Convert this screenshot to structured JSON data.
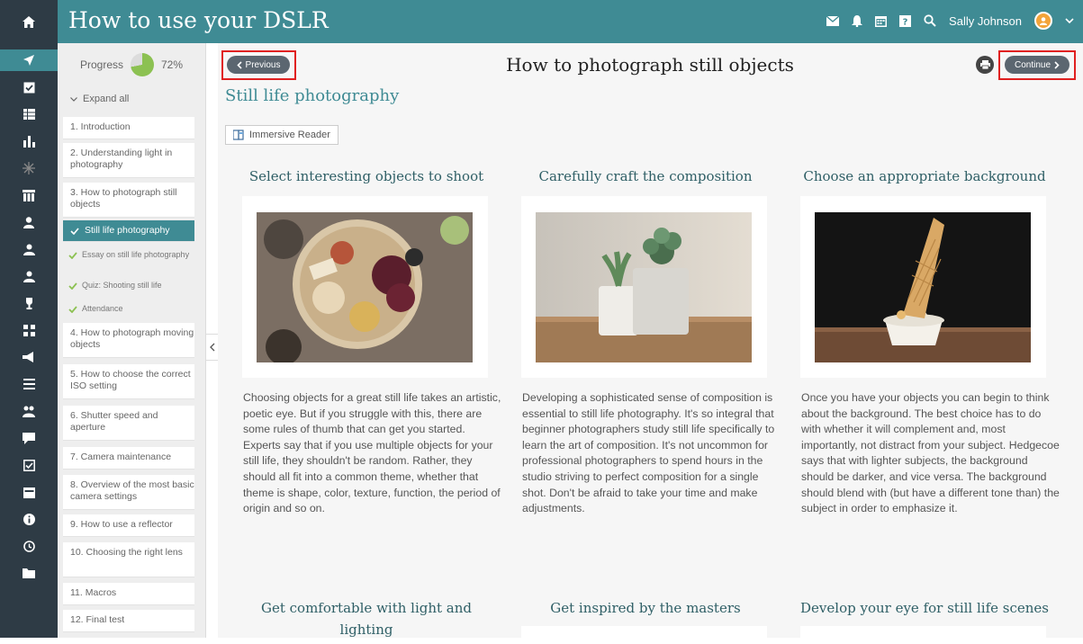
{
  "app": {
    "title": "How to use your DSLR"
  },
  "header": {
    "user_name": "Sally Johnson"
  },
  "toc": {
    "progress_label": "Progress",
    "progress_value": "72%",
    "expand_all": "Expand all",
    "items": [
      "1. Introduction",
      "2. Understanding light in photography",
      "3. How to photograph still objects",
      "Still life photography",
      "Essay on still life photography",
      "Quiz: Shooting still life",
      "Attendance",
      "4. How to photograph moving objects",
      "5. How to choose the correct ISO setting",
      "6. Shutter speed and aperture",
      "7. Camera maintenance",
      "8. Overview of the most basic camera settings",
      "9. How to use a reflector",
      "10. Choosing the right lens",
      "11. Macros",
      "12. Final test"
    ]
  },
  "lesson": {
    "title": "How to photograph still objects",
    "previous_label": "Previous",
    "continue_label": "Continue",
    "section_heading": "Still life photography",
    "reader_label": "Immersive Reader"
  },
  "columns": [
    {
      "title": "Select interesting objects to shoot",
      "text": "Choosing objects for a great still life takes an artistic, poetic eye. But if you struggle with this, there are some rules of thumb that can get you started. Experts say that if you use multiple objects for your still life, they shouldn't be random. Rather, they should all fit into a common theme, whether that theme is shape, color, texture, function, the period of origin and so on."
    },
    {
      "title": "Carefully craft the composition",
      "text": "Developing a sophisticated sense of composition is essential to still life photography. It's so integral that beginner photographers study still life specifically to learn the art of composition. It's not uncommon for professional photographers to spend hours in the studio striving to perfect composition for a single shot. Don't be afraid to take your time and make adjustments."
    },
    {
      "title": "Choose an appropriate background",
      "text": "Once you have your objects you can begin to think about the background. The best choice has to do with whether it will complement and, most importantly, not distract from your subject. Hedgecoe says that with lighter subjects, the background should be darker, and vice versa. The background should blend with (but have a different tone than) the subject in order to emphasize it."
    }
  ],
  "next_columns": [
    "Get comfortable with light and lighting",
    "Get inspired by the masters",
    "Develop your eye for still life scenes"
  ]
}
